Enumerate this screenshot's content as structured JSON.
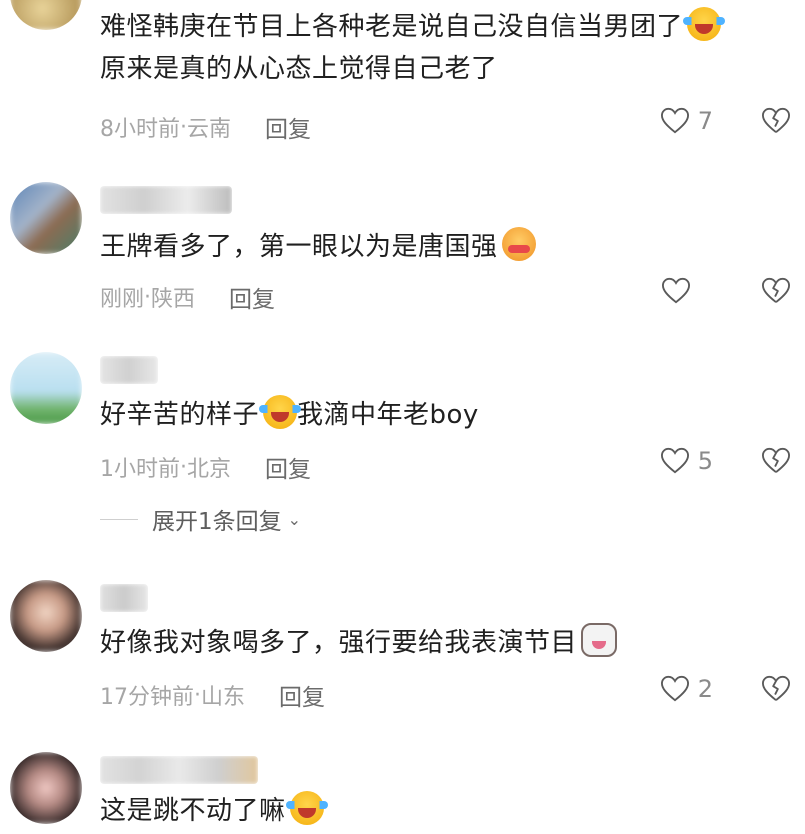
{
  "comments": [
    {
      "text": "难怪韩庚在节目上各种老是说自己没自信当男团了",
      "text2": "原来是真的从心态上觉得自己老了",
      "emoji": "laughing-crying-emoji",
      "time": "8小时前",
      "location": "云南",
      "reply_label": "回复",
      "likes": "7"
    },
    {
      "text": "王牌看多了，第一眼以为是唐国强",
      "emoji": "smug-laugh-emoji",
      "time": "刚刚",
      "location": "陕西",
      "reply_label": "回复",
      "likes": ""
    },
    {
      "text_before": "好辛苦的样子",
      "emoji": "laughing-crying-emoji",
      "text_after": "我滴中年老boy",
      "time": "1小时前",
      "location": "北京",
      "reply_label": "回复",
      "likes": "5",
      "expand_label": "展开1条回复"
    },
    {
      "text": "好像我对象喝多了，强行要给我表演节目",
      "emoji": "cat-emoji",
      "time": "17分钟前",
      "location": "山东",
      "reply_label": "回复",
      "likes": "2"
    },
    {
      "text": "这是跳不动了嘛",
      "emoji": "laughing-crying-emoji"
    }
  ],
  "separator": " · ",
  "colors": {
    "meta": "#a6a6a6",
    "reply": "#6b6b6b",
    "text": "#202020"
  }
}
